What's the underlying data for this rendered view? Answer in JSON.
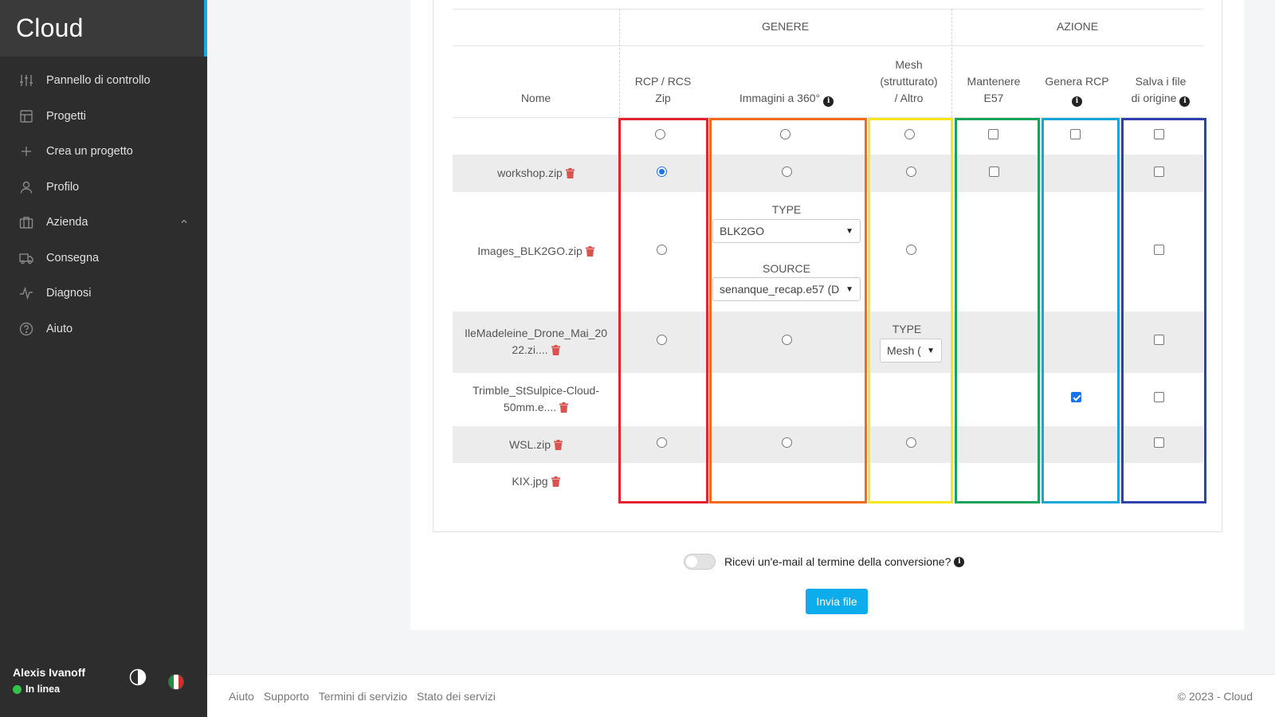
{
  "app": {
    "brand": "Cloud"
  },
  "sidebar": {
    "items": [
      {
        "label": "Pannello di controllo",
        "icon": "sliders-icon"
      },
      {
        "label": "Progetti",
        "icon": "layout-icon"
      },
      {
        "label": "Crea un progetto",
        "icon": "plus-icon"
      },
      {
        "label": "Profilo",
        "icon": "user-icon"
      },
      {
        "label": "Azienda",
        "icon": "briefcase-icon",
        "expanded": true
      },
      {
        "label": "Consegna",
        "icon": "truck-icon"
      },
      {
        "label": "Diagnosi",
        "icon": "activity-icon"
      },
      {
        "label": "Aiuto",
        "icon": "help-circle-icon"
      }
    ],
    "user": {
      "name": "Alexis Ivanoff",
      "status": "In linea"
    }
  },
  "table": {
    "groups": {
      "genere": "GENERE",
      "azione": "AZIONE"
    },
    "columns": {
      "nome": "Nome",
      "rcp": [
        "RCP / RCS",
        "Zip"
      ],
      "img360": "Immagini a 360°",
      "mesh": [
        "Mesh",
        "(strutturato)",
        "/ Altro"
      ],
      "e57": [
        "Mantenere",
        "E57"
      ],
      "genera": [
        "Genera RCP"
      ],
      "salva": [
        "Salva i file",
        "di origine"
      ]
    },
    "rows": [
      {
        "name": "workshop.zip"
      },
      {
        "name": "Images_BLK2GO.zip",
        "type_label": "TYPE",
        "type_value": "BLK2GO",
        "source_label": "SOURCE",
        "source_value": "senanque_recap.e57 (D"
      },
      {
        "name_lines": [
          "IleMadeleine_Drone_Mai_20",
          "22.zi...."
        ],
        "type_label": "TYPE",
        "type_value": "Mesh ("
      },
      {
        "name_lines": [
          "Trimble_StSulpice-Cloud-",
          "50mm.e...."
        ]
      },
      {
        "name": "WSL.zip"
      },
      {
        "name": "KIX.jpg"
      }
    ],
    "frame_colors": [
      "#e3232f",
      "#f26a1b",
      "#f7e61e",
      "#18a35a",
      "#16a6d8",
      "#2f3fae"
    ]
  },
  "email_toggle": {
    "label": "Ricevi un'e-mail al termine della conversione?",
    "checked": false
  },
  "submit": {
    "label": "Invia file"
  },
  "footer": {
    "links": [
      "Aiuto",
      "Supporto",
      "Termini di servizio",
      "Stato dei servizi"
    ],
    "copyright": "© 2023 - Cloud"
  }
}
